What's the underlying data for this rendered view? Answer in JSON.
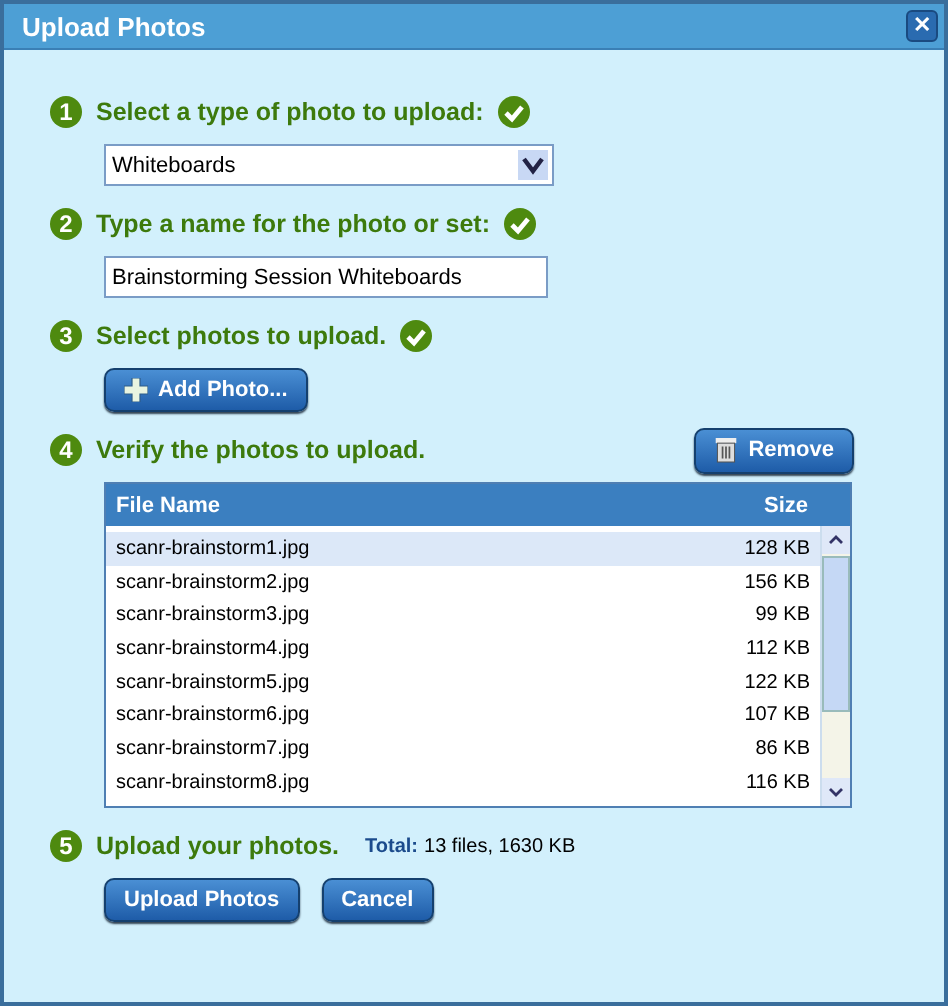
{
  "window": {
    "title": "Upload Photos",
    "close_label": "✕"
  },
  "steps": [
    {
      "kind": "select",
      "number": "1",
      "label": "Select a type of photo to upload:",
      "complete": true,
      "value": "Whiteboards"
    },
    {
      "kind": "text",
      "number": "2",
      "label": "Type a name for the photo or set:",
      "complete": true,
      "value": "Brainstorming Session Whiteboards"
    },
    {
      "kind": "add",
      "number": "3",
      "label": "Select photos to upload.",
      "complete": true,
      "button": "Add Photo..."
    },
    {
      "kind": "table",
      "number": "4",
      "label": "Verify the photos to upload.",
      "complete": false,
      "button": "Remove",
      "columns": [
        "File Name",
        "Size"
      ],
      "rows": [
        {
          "name": "scanr-brainstorm1.jpg",
          "size": "128 KB",
          "selected": true
        },
        {
          "name": "scanr-brainstorm2.jpg",
          "size": "156 KB",
          "selected": false
        },
        {
          "name": "scanr-brainstorm3.jpg",
          "size": "99 KB",
          "selected": false
        },
        {
          "name": "scanr-brainstorm4.jpg",
          "size": "112 KB",
          "selected": false
        },
        {
          "name": "scanr-brainstorm5.jpg",
          "size": "122 KB",
          "selected": false
        },
        {
          "name": "scanr-brainstorm6.jpg",
          "size": "107 KB",
          "selected": false
        },
        {
          "name": "scanr-brainstorm7.jpg",
          "size": "86 KB",
          "selected": false
        },
        {
          "name": "scanr-brainstorm8.jpg",
          "size": "116 KB",
          "selected": false
        }
      ]
    },
    {
      "kind": "upload",
      "number": "5",
      "label": "Upload your photos.",
      "complete": false,
      "total_label": "Total:",
      "total": "13 files, 1630 KB",
      "buttons": [
        "Upload Photos",
        "Cancel"
      ]
    }
  ]
}
